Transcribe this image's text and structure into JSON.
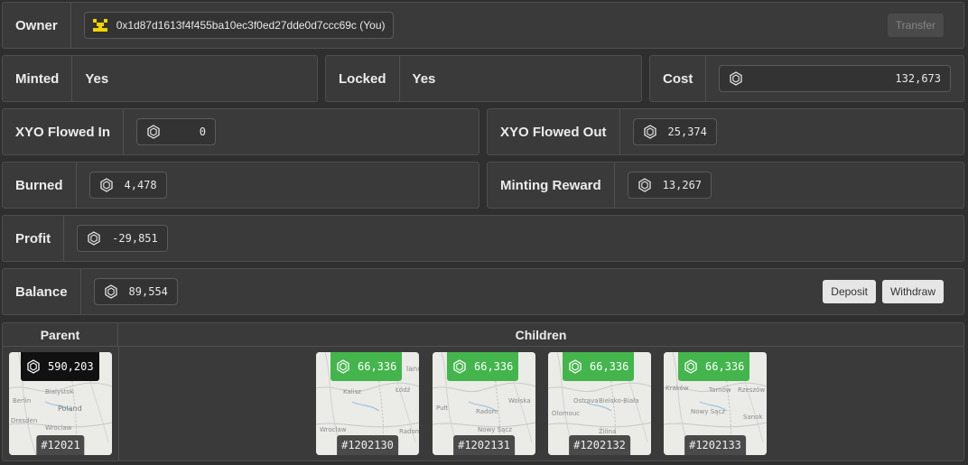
{
  "owner": {
    "label": "Owner",
    "address": "0x1d87d1613f4f455ba10ec3f0ed27dde0d7ccc69c (You)",
    "transfer_label": "Transfer"
  },
  "minted": {
    "label": "Minted",
    "value": "Yes"
  },
  "locked": {
    "label": "Locked",
    "value": "Yes"
  },
  "cost": {
    "label": "Cost",
    "value": "132,673"
  },
  "flowed_in": {
    "label": "XYO Flowed In",
    "value": "0"
  },
  "flowed_out": {
    "label": "XYO Flowed Out",
    "value": "25,374"
  },
  "burned": {
    "label": "Burned",
    "value": "4,478"
  },
  "minting_reward": {
    "label": "Minting Reward",
    "value": "13,267"
  },
  "profit": {
    "label": "Profit",
    "value": "-29,851"
  },
  "balance": {
    "label": "Balance",
    "value": "89,554",
    "deposit_label": "Deposit",
    "withdraw_label": "Withdraw"
  },
  "tree": {
    "parent_header": "Parent",
    "children_header": "Children",
    "parent": {
      "value": "590,203",
      "id": "#12021",
      "map_labels": [
        "Bialystok",
        "Berlin",
        "Poland",
        "Dresden",
        "Wroclaw"
      ]
    },
    "children": [
      {
        "value": "66,336",
        "id": "#1202130",
        "map_labels": [
          "land",
          "Kalisz",
          "Łódź",
          "Wroclaw",
          "Radom"
        ]
      },
      {
        "value": "66,336",
        "id": "#1202131",
        "map_labels": [
          "Pułt",
          "Radom",
          "Wolska",
          "Nowy Sącz"
        ]
      },
      {
        "value": "66,336",
        "id": "#1202132",
        "map_labels": [
          "Ostrava",
          "Bielsko-Biała",
          "Olomouc",
          "Žilina"
        ]
      },
      {
        "value": "66,336",
        "id": "#1202133",
        "map_labels": [
          "Kraków",
          "Tarnów",
          "Rzeszów",
          "Nowy Sącz",
          "Sanok"
        ]
      }
    ]
  },
  "colors": {
    "accent_green": "#43b54c",
    "owner_icon": "#f2d400",
    "background": "#2f2f2f",
    "panel": "#3a3a3a"
  }
}
